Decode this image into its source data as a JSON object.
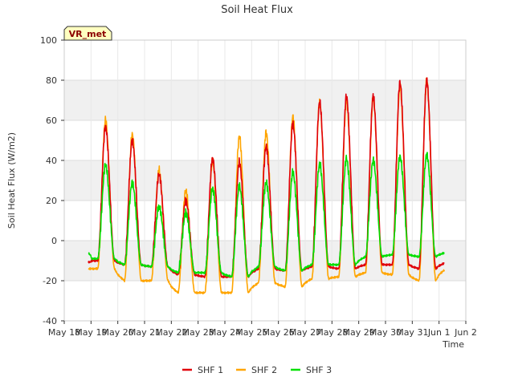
{
  "chart_data": {
    "type": "line",
    "title": "Soil Heat Flux",
    "xlabel": "Time",
    "ylabel": "Soil Heat Flux (W/m2)",
    "badge": "VR_met",
    "xlim": [
      18.0,
      33.0
    ],
    "ylim": [
      -40,
      100
    ],
    "x_ticks": [
      {
        "x": 18,
        "label": "May 18"
      },
      {
        "x": 19,
        "label": "May 19"
      },
      {
        "x": 20,
        "label": "May 20"
      },
      {
        "x": 21,
        "label": "May 21"
      },
      {
        "x": 22,
        "label": "May 22"
      },
      {
        "x": 23,
        "label": "May 23"
      },
      {
        "x": 24,
        "label": "May 24"
      },
      {
        "x": 25,
        "label": "May 25"
      },
      {
        "x": 26,
        "label": "May 26"
      },
      {
        "x": 27,
        "label": "May 27"
      },
      {
        "x": 28,
        "label": "May 28"
      },
      {
        "x": 29,
        "label": "May 29"
      },
      {
        "x": 30,
        "label": "May 30"
      },
      {
        "x": 31,
        "label": "May 31"
      },
      {
        "x": 32,
        "label": "Jun 1"
      },
      {
        "x": 33,
        "label": "Jun 2"
      }
    ],
    "y_ticks": [
      -40,
      -20,
      0,
      20,
      40,
      60,
      80,
      100
    ],
    "grid": true,
    "band_fill": "#f0f0f0",
    "legend_position": "bottom-center",
    "x_start": 18.9,
    "x_end": 32.2,
    "series": [
      {
        "name": "SHF 1",
        "color": "#e0000b",
        "days": [
          {
            "day": 19,
            "min": -10,
            "max": 57
          },
          {
            "day": 20,
            "min": -12,
            "max": 50
          },
          {
            "day": 21,
            "min": -13,
            "max": 33
          },
          {
            "day": 22,
            "min": -17,
            "max": 20
          },
          {
            "day": 23,
            "min": -18,
            "max": 41
          },
          {
            "day": 24,
            "min": -18,
            "max": 39
          },
          {
            "day": 25,
            "min": -14,
            "max": 47
          },
          {
            "day": 26,
            "min": -15,
            "max": 58
          },
          {
            "day": 27,
            "min": -13,
            "max": 69
          },
          {
            "day": 28,
            "min": -14,
            "max": 72
          },
          {
            "day": 29,
            "min": -12,
            "max": 72
          },
          {
            "day": 30,
            "min": -12,
            "max": 79
          },
          {
            "day": 31,
            "min": -14,
            "max": 80
          },
          {
            "day": 32,
            "min": -11,
            "max": 84
          }
        ]
      },
      {
        "name": "SHF 2",
        "color": "#ffa500",
        "days": [
          {
            "day": 19,
            "min": -14,
            "max": 60
          },
          {
            "day": 20,
            "min": -20,
            "max": 53
          },
          {
            "day": 21,
            "min": -20,
            "max": 35
          },
          {
            "day": 22,
            "min": -26,
            "max": 25
          },
          {
            "day": 23,
            "min": -26,
            "max": 40
          },
          {
            "day": 24,
            "min": -26,
            "max": 52
          },
          {
            "day": 25,
            "min": -21,
            "max": 54
          },
          {
            "day": 26,
            "min": -23,
            "max": 62
          },
          {
            "day": 27,
            "min": -19,
            "max": 69
          },
          {
            "day": 28,
            "min": -18,
            "max": 70
          },
          {
            "day": 29,
            "min": -16,
            "max": 71
          },
          {
            "day": 30,
            "min": -17,
            "max": 77
          },
          {
            "day": 31,
            "min": -20,
            "max": 80
          },
          {
            "day": 32,
            "min": -14,
            "max": 85
          }
        ]
      },
      {
        "name": "SHF 3",
        "color": "#00e000",
        "days": [
          {
            "day": 19,
            "min": -9,
            "max": 38
          },
          {
            "day": 20,
            "min": -12,
            "max": 29
          },
          {
            "day": 21,
            "min": -13,
            "max": 17
          },
          {
            "day": 22,
            "min": -16,
            "max": 14
          },
          {
            "day": 23,
            "min": -16,
            "max": 26
          },
          {
            "day": 24,
            "min": -18,
            "max": 27
          },
          {
            "day": 25,
            "min": -13,
            "max": 29
          },
          {
            "day": 26,
            "min": -15,
            "max": 34
          },
          {
            "day": 27,
            "min": -12,
            "max": 38
          },
          {
            "day": 28,
            "min": -12,
            "max": 41
          },
          {
            "day": 29,
            "min": -8,
            "max": 40
          },
          {
            "day": 30,
            "min": -7,
            "max": 42
          },
          {
            "day": 31,
            "min": -8,
            "max": 43
          },
          {
            "day": 32,
            "min": -6,
            "max": 44
          }
        ]
      }
    ]
  }
}
